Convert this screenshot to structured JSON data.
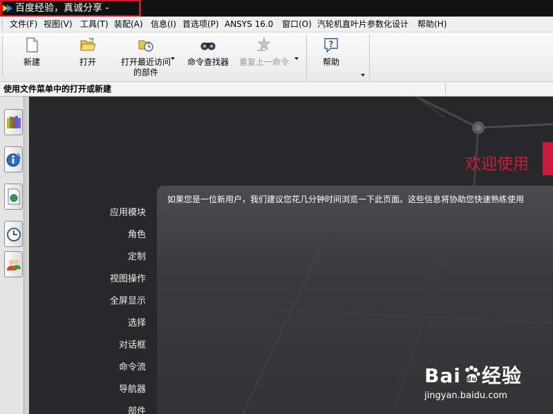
{
  "window": {
    "title": "百度经验，真诚分享 -"
  },
  "menu": {
    "items": [
      "文件(F)",
      "视图(V)",
      "工具(T)",
      "装配(A)",
      "信息(I)",
      "首选项(P)",
      "ANSYS 16.0",
      "窗口(O)",
      "汽轮机直叶片参数化设计",
      "帮助(H)"
    ]
  },
  "toolbar": {
    "new_label": "新建",
    "open_label": "打开",
    "open_recent_label": [
      "打开最近访问",
      "的部件"
    ],
    "command_finder_label": "命令查找器",
    "repeat_command_label": "重复上一命令",
    "help_label": "帮助"
  },
  "status": {
    "message": "使用文件菜单中的打开或新建"
  },
  "welcome": {
    "title": "欢迎使用"
  },
  "nav": {
    "items": [
      "应用模块",
      "角色",
      "定制",
      "视图操作",
      "全屏显示",
      "选择",
      "对话框",
      "命令流",
      "导航器",
      "部件"
    ]
  },
  "intro": {
    "text": "如果您是一位新用户，我们建议您花几分钟时间浏览一下此页面。这些信息将协助您快速熟练使用"
  },
  "watermark": {
    "brand_left": "Bai",
    "brand_right": "经验",
    "url": "jingyan.baidu.com"
  },
  "colors": {
    "accent_red": "#d01a3c",
    "highlight_box": "#e0141e"
  }
}
